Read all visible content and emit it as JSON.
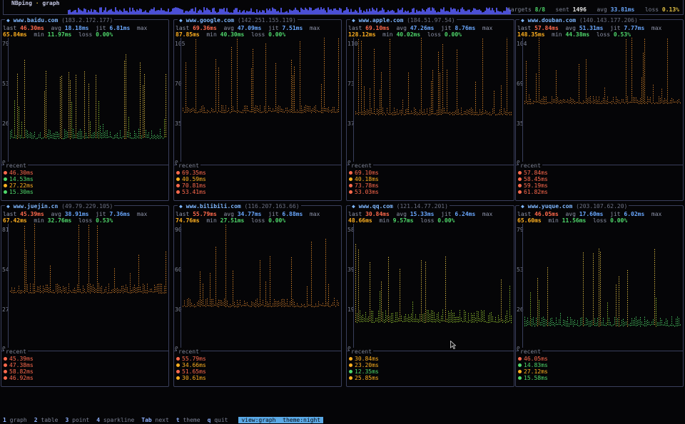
{
  "app": {
    "name": "NBping",
    "sep": "·",
    "view": "graph"
  },
  "stats": {
    "targets_label": "targets",
    "targets": "8/8",
    "sent_label": "sent",
    "sent": "1496",
    "avg_label": "avg",
    "avg": "33.81ms",
    "loss_label": "loss",
    "loss": "0.13%"
  },
  "colors": {
    "accent": "#7fb7ff",
    "last": "#ff6a4d",
    "max": "#ffb020",
    "ok": "#4fd86b",
    "warn": "#e2c044",
    "border": "#3a3f5c",
    "spark": "#4b4fd6"
  },
  "labels": {
    "last": "last",
    "avg": "avg",
    "jit": "jit",
    "max": "max",
    "min": "min",
    "loss": "loss",
    "recent": "recent"
  },
  "panels": [
    {
      "host": "www.baidu.com",
      "ip": "(183.2.172.177)",
      "last": "46.30ms",
      "avg": "18.18ms",
      "jit": "6.81ms",
      "max": "65.84ms",
      "min": "11.97ms",
      "loss": "0.00%",
      "ylabels": [
        "79",
        "53",
        "26",
        "0"
      ],
      "ymax": 79,
      "base": 18,
      "col": "green",
      "recent": [
        {
          "v": "46.30ms",
          "c": "#ff6a4d"
        },
        {
          "v": "14.53ms",
          "c": "#4fd86b"
        },
        {
          "v": "27.22ms",
          "c": "#ffb020"
        },
        {
          "v": "15.30ms",
          "c": "#4fd86b"
        }
      ]
    },
    {
      "host": "www.google.com",
      "ip": "(142.251.155.119)",
      "last": "69.36ms",
      "avg": "47.09ms",
      "jit": "7.51ms",
      "max": "87.85ms",
      "min": "40.30ms",
      "loss": "0.00%",
      "ylabels": [
        "105",
        "70",
        "35",
        "0"
      ],
      "ymax": 105,
      "base": 45,
      "col": "orange",
      "recent": [
        {
          "v": "69.35ms",
          "c": "#ff6a4d"
        },
        {
          "v": "40.59ms",
          "c": "#ffb020"
        },
        {
          "v": "70.81ms",
          "c": "#ff6a4d"
        },
        {
          "v": "53.41ms",
          "c": "#ff6a4d"
        }
      ]
    },
    {
      "host": "www.apple.com",
      "ip": "(184.51.97.54)",
      "last": "69.10ms",
      "avg": "47.26ms",
      "jit": "8.76ms",
      "max": "128.12ms",
      "min": "40.02ms",
      "loss": "0.00%",
      "ylabels": [
        "110",
        "73",
        "37",
        "0"
      ],
      "ymax": 110,
      "base": 45,
      "col": "orange",
      "recent": [
        {
          "v": "69.10ms",
          "c": "#ff6a4d"
        },
        {
          "v": "40.18ms",
          "c": "#ffb020"
        },
        {
          "v": "73.78ms",
          "c": "#ff6a4d"
        },
        {
          "v": "53.03ms",
          "c": "#ff6a4d"
        }
      ]
    },
    {
      "host": "www.douban.com",
      "ip": "(140.143.177.206)",
      "last": "57.84ms",
      "avg": "51.31ms",
      "jit": "7.77ms",
      "max": "148.35ms",
      "min": "44.38ms",
      "loss": "0.53%",
      "ylabels": [
        "104",
        "69",
        "35",
        "0"
      ],
      "ymax": 104,
      "base": 52,
      "col": "orange",
      "recent": [
        {
          "v": "57.84ms",
          "c": "#ff6a4d"
        },
        {
          "v": "58.45ms",
          "c": "#ff6a4d"
        },
        {
          "v": "59.19ms",
          "c": "#ff6a4d"
        },
        {
          "v": "61.82ms",
          "c": "#ff6a4d"
        }
      ]
    },
    {
      "host": "www.juejin.cn",
      "ip": "(49.79.229.105)",
      "last": "45.39ms",
      "avg": "38.91ms",
      "jit": "7.36ms",
      "max": "67.42ms",
      "min": "32.76ms",
      "loss": "0.53%",
      "ylabels": [
        "81",
        "54",
        "27",
        "0"
      ],
      "ymax": 81,
      "base": 39,
      "col": "orange",
      "recent": [
        {
          "v": "45.39ms",
          "c": "#ff6a4d"
        },
        {
          "v": "47.38ms",
          "c": "#ff6a4d"
        },
        {
          "v": "58.82ms",
          "c": "#ff6a4d"
        },
        {
          "v": "46.92ms",
          "c": "#ff6a4d"
        }
      ]
    },
    {
      "host": "www.bilibili.com",
      "ip": "(116.207.163.66)",
      "last": "55.79ms",
      "avg": "34.77ms",
      "jit": "6.88ms",
      "max": "74.76ms",
      "min": "27.51ms",
      "loss": "0.00%",
      "ylabels": [
        "90",
        "60",
        "30",
        "0"
      ],
      "ymax": 90,
      "base": 33,
      "col": "orange",
      "recent": [
        {
          "v": "55.79ms",
          "c": "#ff6a4d"
        },
        {
          "v": "34.66ms",
          "c": "#ffb020"
        },
        {
          "v": "51.65ms",
          "c": "#ff6a4d"
        },
        {
          "v": "30.61ms",
          "c": "#ffb020"
        }
      ]
    },
    {
      "host": "www.qq.com",
      "ip": "(121.14.77.201)",
      "last": "30.84ms",
      "avg": "15.33ms",
      "jit": "6.24ms",
      "max": "48.66ms",
      "min": "9.57ms",
      "loss": "0.00%",
      "ylabels": [
        "58",
        "39",
        "19",
        "0"
      ],
      "ymax": 58,
      "base": 15,
      "col": "mixed",
      "recent": [
        {
          "v": "30.84ms",
          "c": "#ffb020"
        },
        {
          "v": "23.20ms",
          "c": "#ffb020"
        },
        {
          "v": "12.35ms",
          "c": "#4fd86b"
        },
        {
          "v": "25.85ms",
          "c": "#ffb020"
        }
      ]
    },
    {
      "host": "www.yuque.com",
      "ip": "(203.107.62.20)",
      "last": "46.05ms",
      "avg": "17.60ms",
      "jit": "6.02ms",
      "max": "65.60ms",
      "min": "11.56ms",
      "loss": "0.00%",
      "ylabels": [
        "79",
        "53",
        "26",
        "0"
      ],
      "ymax": 79,
      "base": 17,
      "col": "green",
      "recent": [
        {
          "v": "46.05ms",
          "c": "#ff6a4d"
        },
        {
          "v": "14.83ms",
          "c": "#4fd86b"
        },
        {
          "v": "27.12ms",
          "c": "#ffb020"
        },
        {
          "v": "15.58ms",
          "c": "#4fd86b"
        }
      ]
    }
  ],
  "footer": [
    {
      "key": "1",
      "label": "graph"
    },
    {
      "key": "2",
      "label": "table"
    },
    {
      "key": "3",
      "label": "point"
    },
    {
      "key": "4",
      "label": "sparkline"
    },
    {
      "key": "Tab",
      "label": "next"
    },
    {
      "key": "t",
      "label": "theme"
    },
    {
      "key": "q",
      "label": "quit"
    }
  ],
  "mode": {
    "view": "view:graph",
    "theme": "theme:night"
  }
}
